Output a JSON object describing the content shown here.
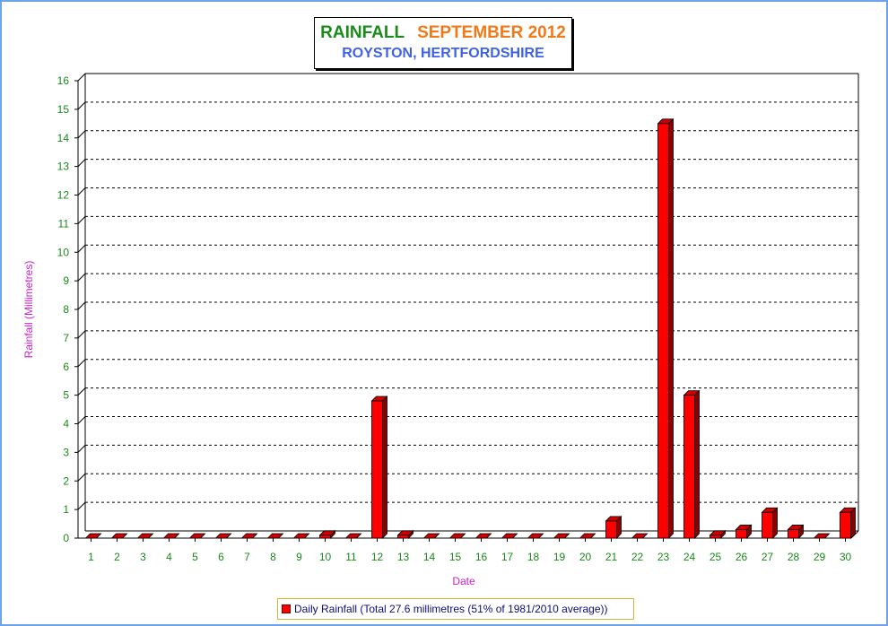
{
  "title": {
    "part1": "RAINFALL",
    "part2": "SEPTEMBER 2012",
    "subtitle": "ROYSTON, HERTFORDSHIRE"
  },
  "legend_label": "Daily Rainfall (Total 27.6 millimetres (51% of 1981/2010 average))",
  "colors": {
    "bar": "#ff0000",
    "tick_text": "#1a8a1a",
    "axis_title": "#cc22cc",
    "title_green": "#1a8a1a",
    "title_orange": "#f07a1a",
    "subtitle_blue": "#3f62e6"
  },
  "chart_data": {
    "type": "bar",
    "categories": [
      "1",
      "2",
      "3",
      "4",
      "5",
      "6",
      "7",
      "8",
      "9",
      "10",
      "11",
      "12",
      "13",
      "14",
      "15",
      "16",
      "17",
      "18",
      "19",
      "20",
      "21",
      "22",
      "23",
      "24",
      "25",
      "26",
      "27",
      "28",
      "29",
      "30"
    ],
    "series": [
      {
        "name": "Daily Rainfall (Total 27.6 millimetres (51% of 1981/2010 average))",
        "values": [
          0,
          0,
          0,
          0,
          0,
          0,
          0,
          0,
          0,
          0.1,
          0,
          4.8,
          0.1,
          0,
          0,
          0,
          0,
          0,
          0,
          0,
          0.6,
          0,
          14.5,
          5.0,
          0.1,
          0.3,
          0.9,
          0.3,
          0,
          0.9
        ]
      }
    ],
    "xlabel": "Date",
    "ylabel": "Rainfall  (Millimetres)",
    "ylim": [
      0,
      16
    ],
    "yticks": [
      "0",
      "1",
      "2",
      "3",
      "4",
      "5",
      "6",
      "7",
      "8",
      "9",
      "10",
      "11",
      "12",
      "13",
      "14",
      "15",
      "16"
    ],
    "grid": true,
    "legend_position": "bottom"
  }
}
